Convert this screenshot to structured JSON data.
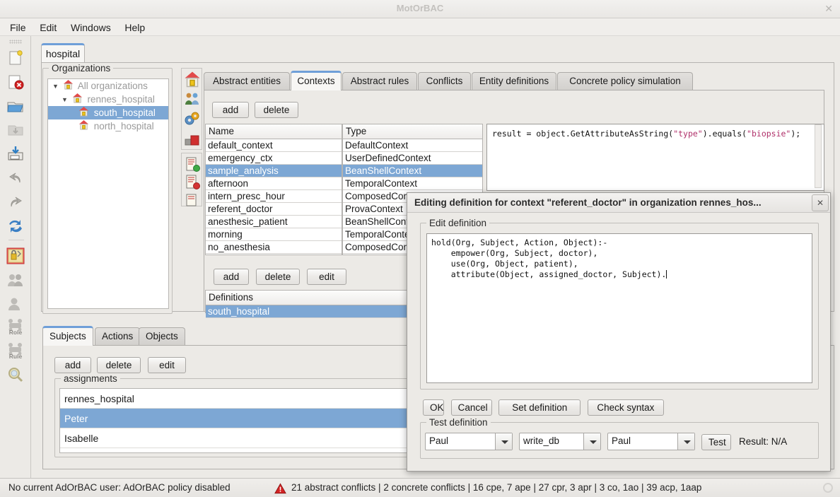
{
  "window": {
    "title": "MotOrBAC",
    "close_icon": "close-icon"
  },
  "menubar": {
    "items": [
      "File",
      "Edit",
      "Windows",
      "Help"
    ]
  },
  "left_toolbar": {
    "items": [
      {
        "name": "new-policy-icon",
        "label": "new"
      },
      {
        "name": "close-policy-icon",
        "label": "close"
      },
      {
        "name": "open-policy-icon",
        "label": "open"
      },
      {
        "name": "save-policy-icon",
        "label": "save"
      },
      {
        "name": "save-as-policy-icon",
        "label": "save as"
      },
      {
        "name": "undo-icon",
        "label": "undo"
      },
      {
        "name": "redo-icon",
        "label": "redo"
      },
      {
        "name": "refresh-icon",
        "label": "refresh"
      },
      {
        "name": "security-rules-icon",
        "label": "security rules"
      },
      {
        "name": "users-group-icon",
        "label": "users"
      },
      {
        "name": "user-icon",
        "label": "user"
      },
      {
        "name": "role-icon",
        "label": "Role"
      },
      {
        "name": "rule-icon",
        "label": "Rule"
      },
      {
        "name": "search-policy-icon",
        "label": "search"
      }
    ],
    "role_label": "Role",
    "rule_label": "Rule"
  },
  "policy_tab": {
    "label": "hospital"
  },
  "organizations": {
    "group_label": "Organizations",
    "tree": [
      {
        "label": "All organizations",
        "depth": 0,
        "twisty": "expanded",
        "selected": false
      },
      {
        "label": "rennes_hospital",
        "depth": 1,
        "twisty": "expanded",
        "selected": false
      },
      {
        "label": "south_hospital",
        "depth": 2,
        "twisty": "none",
        "selected": true
      },
      {
        "label": "north_hospital",
        "depth": 2,
        "twisty": "none",
        "selected": false
      }
    ]
  },
  "middle_toolbar": {
    "group1": [
      {
        "name": "organization-icon"
      },
      {
        "name": "subjects-icon"
      },
      {
        "name": "actions-icon"
      },
      {
        "name": "objects-icon"
      }
    ],
    "group2": [
      {
        "name": "permission-rule-icon"
      },
      {
        "name": "prohibition-rule-icon"
      },
      {
        "name": "obligation-rule-icon"
      }
    ]
  },
  "main_tabs": {
    "items": [
      {
        "label": "Abstract entities",
        "active": false
      },
      {
        "label": "Contexts",
        "active": true
      },
      {
        "label": "Abstract rules",
        "active": false
      },
      {
        "label": "Conflicts",
        "active": false
      },
      {
        "label": "Entity definitions",
        "active": false
      },
      {
        "label": "Concrete policy simulation",
        "active": false
      }
    ]
  },
  "contexts_panel": {
    "top_buttons": [
      "add",
      "delete"
    ],
    "table": {
      "headers": [
        "Name",
        "Type"
      ],
      "rows": [
        {
          "name": "default_context",
          "type": "DefaultContext",
          "selected": false
        },
        {
          "name": "emergency_ctx",
          "type": "UserDefinedContext",
          "selected": false
        },
        {
          "name": "sample_analysis",
          "type": "BeanShellContext",
          "selected": true
        },
        {
          "name": "afternoon",
          "type": "TemporalContext",
          "selected": false
        },
        {
          "name": "intern_presc_hour",
          "type": "ComposedContext",
          "selected": false
        },
        {
          "name": "referent_doctor",
          "type": "ProvaContext",
          "selected": false
        },
        {
          "name": "anesthesic_patient",
          "type": "BeanShellContext",
          "selected": false
        },
        {
          "name": "morning",
          "type": "TemporalContext",
          "selected": false
        },
        {
          "name": "no_anesthesia",
          "type": "ComposedContext",
          "selected": false
        }
      ]
    },
    "code_preview": {
      "prefix": "result = object.GetAttributeAsString(",
      "string1": "\"type\"",
      "middle": ").equals(",
      "string2": "\"biopsie\"",
      "suffix": ");"
    },
    "bottom_buttons": [
      "add",
      "delete",
      "edit"
    ],
    "definitions": {
      "header": "Definitions",
      "rows": [
        {
          "label": "south_hospital",
          "selected": true
        }
      ]
    }
  },
  "bottom_tabs": {
    "items": [
      {
        "label": "Subjects",
        "active": true
      },
      {
        "label": "Actions",
        "active": false
      },
      {
        "label": "Objects",
        "active": false
      }
    ],
    "buttons": [
      "add",
      "delete",
      "edit"
    ],
    "assignments": {
      "group_label": "assignments",
      "rows": [
        {
          "label": "rennes_hospital",
          "selected": false
        },
        {
          "label": "Peter",
          "selected": true
        },
        {
          "label": "Isabelle",
          "selected": false
        }
      ]
    }
  },
  "dialog": {
    "title": "Editing definition for context \"referent_doctor\" in organization rennes_hos...",
    "close_icon": "close-icon",
    "edit_group_label": "Edit definition",
    "definition_code": "hold(Org, Subject, Action, Object):-\n    empower(Org, Subject, doctor),\n    use(Org, Object, patient),\n    attribute(Object, assigned_doctor, Subject).",
    "buttons": [
      "OK",
      "Cancel",
      "Set definition",
      "Check syntax"
    ],
    "test_group_label": "Test definition",
    "test": {
      "subject": "Paul",
      "action": "write_db",
      "object": "Paul",
      "test_button": "Test",
      "result": "Result: N/A"
    }
  },
  "statusbar": {
    "user_text": "No current AdOrBAC user: AdOrBAC policy disabled",
    "warning_icon": "warning-triangle-icon",
    "conflicts_text": "21 abstract conflicts | 2 concrete conflicts | 16 cpe, 7 ape | 27 cpr, 3 apr | 3 co, 1ao | 39 acp, 1aap"
  },
  "colors": {
    "selection": "#7da7d4",
    "tab_accent": "#6f9fd8",
    "panel_bg": "#eceae6",
    "warning": "#cc1f1f",
    "string_literal": "#b0306a"
  }
}
